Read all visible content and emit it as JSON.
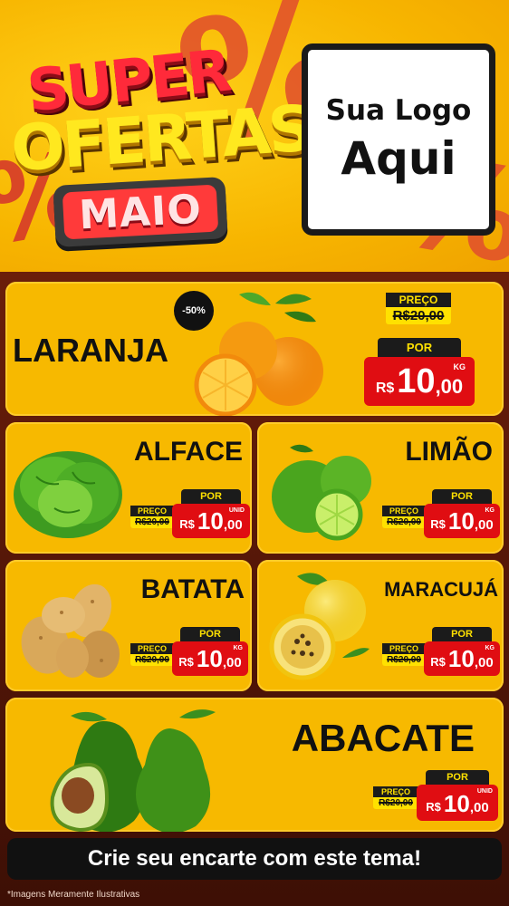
{
  "header": {
    "title_line1": "SUPER",
    "title_line2": "OFERTAS",
    "month": "MAIO",
    "percent_symbol": "%",
    "logo_line1": "Sua Logo",
    "logo_line2": "Aqui"
  },
  "products": {
    "laranja": {
      "name": "LARANJA",
      "discount": "-50%",
      "old_label": "PREÇO",
      "old_price": "R$20,00",
      "new_label": "POR",
      "currency": "R$",
      "price_int": "10",
      "price_dec": ",00",
      "unit": "KG"
    },
    "alface": {
      "name": "ALFACE",
      "old_label": "PREÇO",
      "old_price": "R$20,00",
      "new_label": "POR",
      "currency": "R$",
      "price_int": "10",
      "price_dec": ",00",
      "unit": "UNID"
    },
    "limao": {
      "name": "LIMÃO",
      "old_label": "PREÇO",
      "old_price": "R$20,00",
      "new_label": "POR",
      "currency": "R$",
      "price_int": "10",
      "price_dec": ",00",
      "unit": "KG"
    },
    "batata": {
      "name": "BATATA",
      "old_label": "PREÇO",
      "old_price": "R$20,00",
      "new_label": "POR",
      "currency": "R$",
      "price_int": "10",
      "price_dec": ",00",
      "unit": "KG"
    },
    "maracuja": {
      "name": "MARACUJÁ",
      "old_label": "PREÇO",
      "old_price": "R$20,00",
      "new_label": "POR",
      "currency": "R$",
      "price_int": "10",
      "price_dec": ",00",
      "unit": "KG"
    },
    "abacate": {
      "name": "ABACATE",
      "old_label": "PREÇO",
      "old_price": "R$20,00",
      "new_label": "POR",
      "currency": "R$",
      "price_int": "10",
      "price_dec": ",00",
      "unit": "UNID"
    }
  },
  "cta": "Crie seu encarte com este tema!",
  "disclaimer": "*Imagens Meramente Ilustrativas",
  "colors": {
    "card_yellow": "#f7b900",
    "price_red": "#e00d12",
    "label_black": "#1b1b1b",
    "label_yellow": "#ffe100"
  },
  "icons": [
    "orange-icon",
    "lettuce-icon",
    "lime-icon",
    "potato-icon",
    "passion-fruit-icon",
    "avocado-icon"
  ]
}
